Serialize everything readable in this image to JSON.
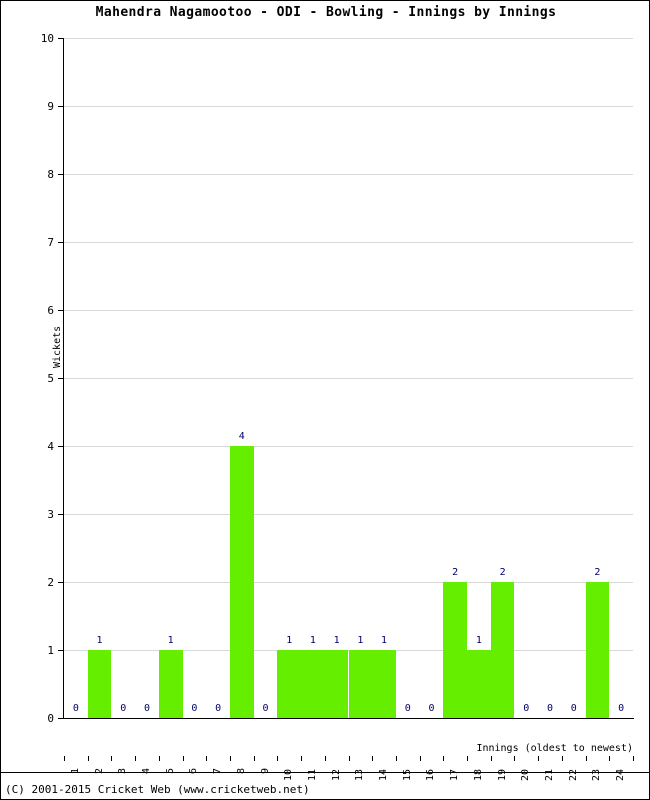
{
  "chart_data": {
    "type": "bar",
    "title": "Mahendra Nagamootoo - ODI - Bowling - Innings by Innings",
    "xlabel": "Innings (oldest to newest)",
    "ylabel": "Wickets",
    "categories": [
      "1",
      "2",
      "3",
      "4",
      "5",
      "6",
      "7",
      "8",
      "9",
      "10",
      "11",
      "12",
      "13",
      "14",
      "15",
      "16",
      "17",
      "18",
      "19",
      "20",
      "21",
      "22",
      "23",
      "24"
    ],
    "values": [
      0,
      1,
      0,
      0,
      1,
      0,
      0,
      4,
      0,
      1,
      1,
      1,
      1,
      1,
      0,
      0,
      2,
      1,
      2,
      0,
      0,
      0,
      2,
      0
    ],
    "ylim": [
      0,
      10
    ],
    "yticks": [
      0,
      1,
      2,
      3,
      4,
      5,
      6,
      7,
      8,
      9,
      10
    ],
    "grid": true,
    "legend": null,
    "bar_color": "#66ee00",
    "value_label_color": "#000066",
    "gridline_color": "#d9d9d9",
    "axis_color": "#000000"
  },
  "footer": {
    "copyright": "(C) 2001-2015 Cricket Web (www.cricketweb.net)"
  }
}
